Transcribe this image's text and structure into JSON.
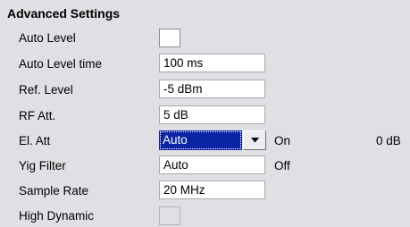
{
  "section_title": "Advanced Settings",
  "rows": [
    {
      "label": "Auto Level"
    },
    {
      "label": "Auto Level time",
      "value": "100 ms"
    },
    {
      "label": "Ref. Level",
      "value": "-5 dBm"
    },
    {
      "label": "RF Att.",
      "value": "5 dB"
    },
    {
      "label": "El. Att",
      "value": "Auto",
      "state": "On",
      "extra": "0 dB"
    },
    {
      "label": "Yig Filter",
      "value": "Auto",
      "state": "Off"
    },
    {
      "label": "Sample Rate",
      "value": "20 MHz"
    },
    {
      "label": "High Dynamic"
    }
  ],
  "colors": {
    "panel_bg": "#e0dfe3",
    "selection": "#0a24a6",
    "field_bg": "#ffffff"
  },
  "icons": {
    "dropdown": "chevron-down-icon"
  }
}
